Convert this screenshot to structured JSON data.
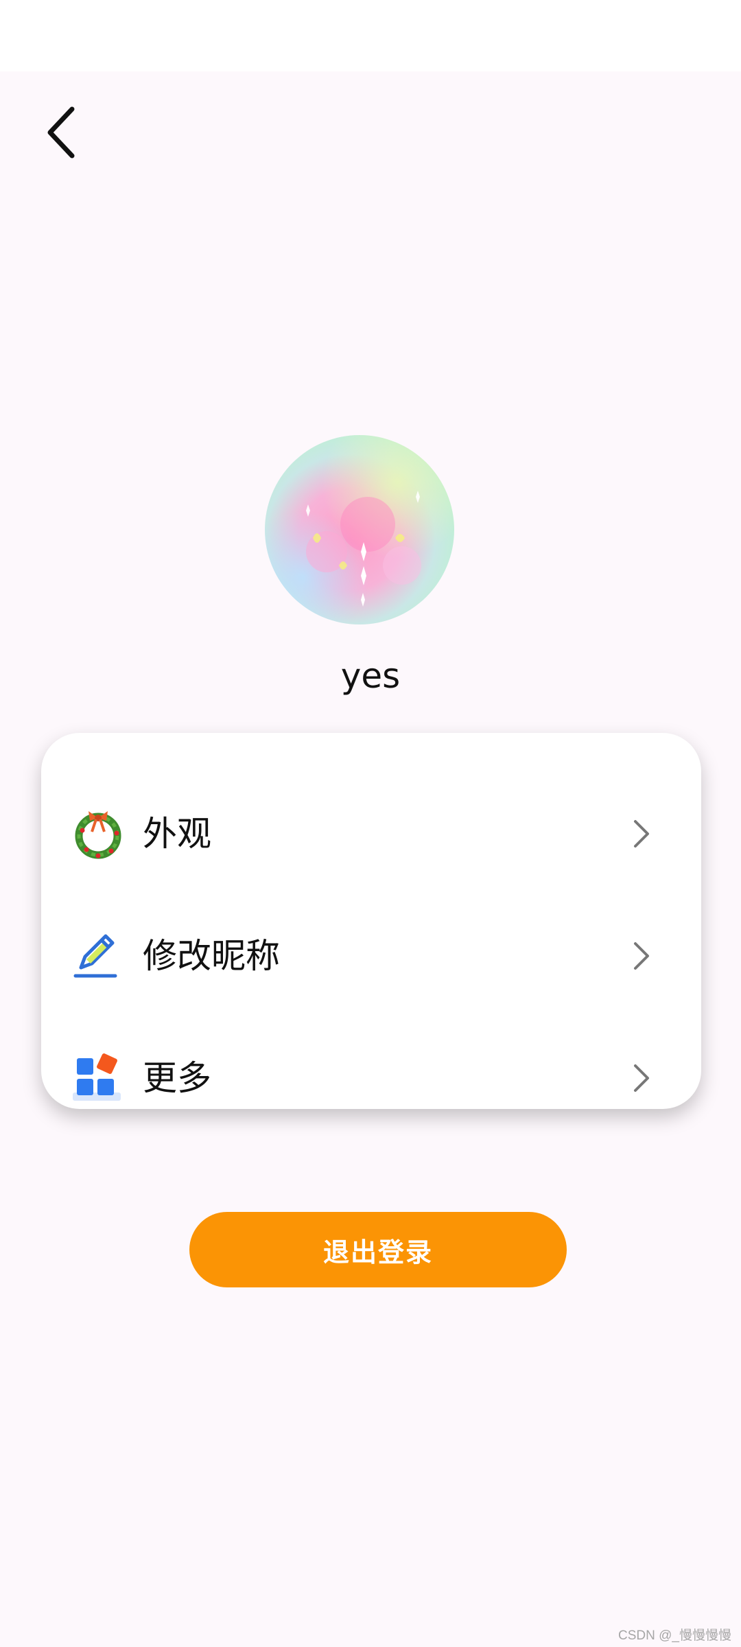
{
  "colors": {
    "page_bg": "#fdf8fc",
    "card_bg": "#ffffff",
    "accent": "#fb9405",
    "chevron": "#777777"
  },
  "header": {
    "back_icon": "chevron-left-icon"
  },
  "profile": {
    "avatar_icon": "pastel-avatar-image",
    "username": "yes"
  },
  "menu": {
    "items": [
      {
        "label": "外观",
        "icon": "wreath-icon"
      },
      {
        "label": "修改昵称",
        "icon": "pencil-icon"
      },
      {
        "label": "更多",
        "icon": "apps-icon"
      }
    ]
  },
  "logout": {
    "label": "退出登录"
  },
  "watermark": "CSDN @_慢慢慢慢"
}
